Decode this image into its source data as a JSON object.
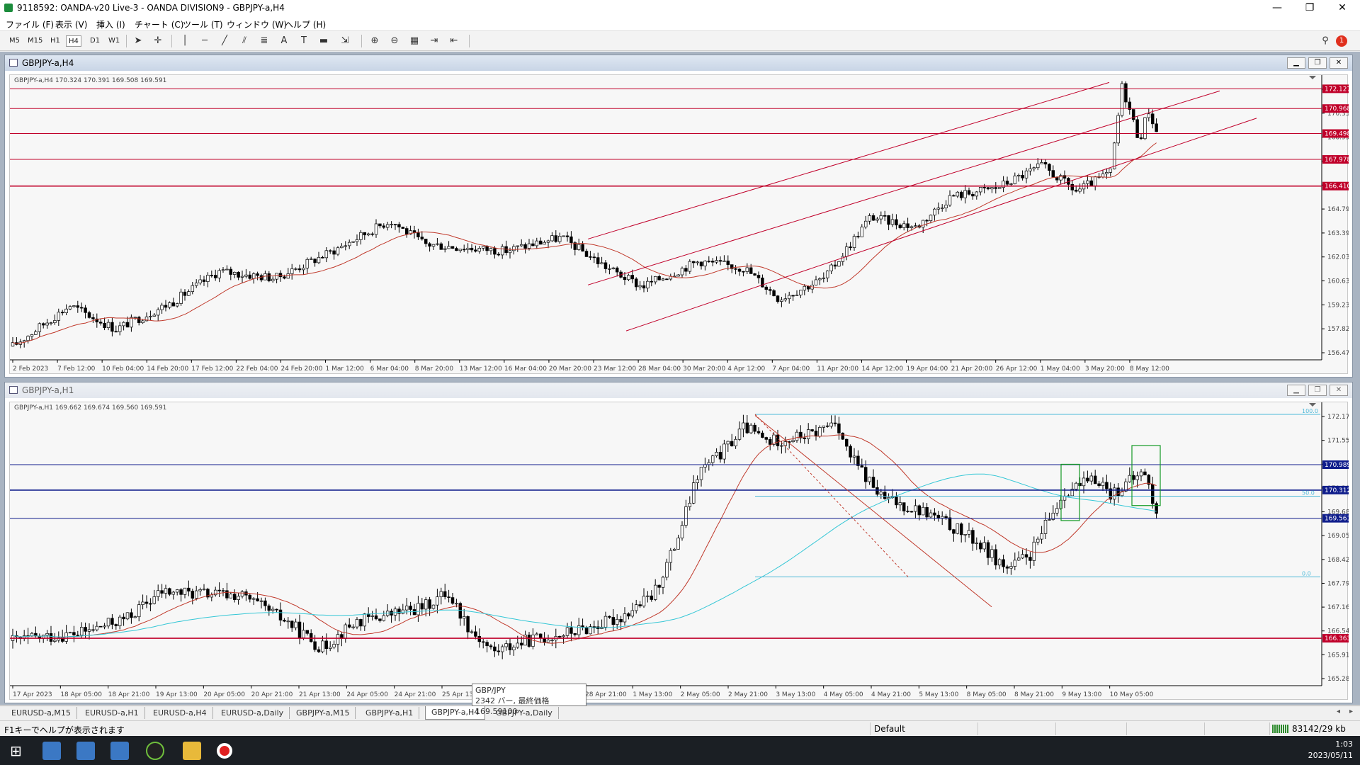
{
  "window": {
    "title": "9118592: OANDA-v20 Live-3 - OANDA DIVISION9 - GBPJPY-a,H4"
  },
  "menu": [
    "ファイル (F)",
    "表示 (V)",
    "挿入 (I)",
    "チャート (C)",
    "ツール (T)",
    "ウィンドウ (W)",
    "ヘルプ (H)"
  ],
  "toolbar": {
    "timeframes": [
      "M5",
      "M15",
      "H1",
      "H4",
      "D1",
      "W1"
    ],
    "active": "H4",
    "text_tool": "A",
    "alert_count": "1"
  },
  "colors": {
    "candle": "#000000",
    "ma_red": "#c0392b",
    "ma_cyan": "#35c7d6",
    "level_red": "#c0002a",
    "level_blue": "#101e8c",
    "box_green": "#159a26",
    "fib": "#4bb8d8"
  },
  "icons": {
    "cursor": "cursor-icon",
    "crosshair": "crosshair-icon",
    "search": "search-icon",
    "zoom_in": "zoom-in-icon",
    "zoom_out": "zoom-out-icon"
  },
  "chart_h4": {
    "window_title": "GBPJPY-a,H4",
    "info": "GBPJPY-a,H4  170.324 170.391 169.508 169.591",
    "price_ticks": [
      "171.750",
      "170.350",
      "168.950",
      "167.590",
      "166.190",
      "164.790",
      "163.390",
      "162.030",
      "160.630",
      "159.230",
      "157.820",
      "156.470"
    ],
    "level_labels": [
      {
        "price": 172.127,
        "text": "172.127"
      },
      {
        "price": 170.968,
        "text": "170.968"
      },
      {
        "price": 169.498,
        "text": "169.498"
      },
      {
        "price": 167.978,
        "text": "167.978"
      },
      {
        "price": 166.41,
        "text": "166.410"
      }
    ],
    "time_labels": [
      "2 Feb 2023",
      "7 Feb 12:00",
      "10 Feb 04:00",
      "14 Feb 20:00",
      "17 Feb 12:00",
      "22 Feb 04:00",
      "24 Feb 20:00",
      "1 Mar 12:00",
      "6 Mar 04:00",
      "8 Mar 20:00",
      "13 Mar 12:00",
      "16 Mar 04:00",
      "20 Mar 20:00",
      "23 Mar 12:00",
      "28 Mar 04:00",
      "30 Mar 20:00",
      "4 Apr 12:00",
      "7 Apr 04:00",
      "11 Apr 20:00",
      "14 Apr 12:00",
      "19 Apr 04:00",
      "21 Apr 20:00",
      "26 Apr 12:00",
      "1 May 04:00",
      "3 May 20:00",
      "8 May 12:00"
    ]
  },
  "chart_h1": {
    "window_title": "GBPJPY-a,H1",
    "info": "GBPJPY-a,H1  169.662 169.674 169.560 169.591",
    "price_ticks": [
      "172.170",
      "171.555",
      "170.935",
      "170.305",
      "169.680",
      "169.050",
      "168.420",
      "167.790",
      "167.160",
      "166.545",
      "165.915",
      "165.285"
    ],
    "level_labels": [
      {
        "price": 170.989,
        "text": "170.989",
        "color": "#101e8c"
      },
      {
        "price": 170.312,
        "text": "170.312",
        "color": "#101e8c"
      },
      {
        "price": 169.561,
        "text": "169.561",
        "color": "#101e8c"
      },
      {
        "price": 166.363,
        "text": "166.363",
        "color": "#c0002a"
      }
    ],
    "fib_labels": [
      "100.0",
      "50.0",
      "0.0"
    ],
    "time_labels": [
      "17 Apr 2023",
      "18 Apr 05:00",
      "18 Apr 21:00",
      "19 Apr 13:00",
      "20 Apr 05:00",
      "20 Apr 21:00",
      "21 Apr 13:00",
      "24 Apr 05:00",
      "24 Apr 21:00",
      "25 Apr 13:00",
      "26",
      "28 Apr 05:00",
      "28 Apr 21:00",
      "1 May 13:00",
      "2 May 05:00",
      "2 May 21:00",
      "3 May 13:00",
      "4 May 05:00",
      "4 May 21:00",
      "5 May 13:00",
      "8 May 05:00",
      "8 May 21:00",
      "9 May 13:00",
      "10 May 05:00"
    ]
  },
  "tooltip": {
    "symbol": "GBP/JPY",
    "detail": "2342 バー, 最終価格 169.59100"
  },
  "tabs": [
    "EURUSD-a,M15",
    "EURUSD-a,H1",
    "EURUSD-a,H4",
    "EURUSD-a,Daily",
    "GBPJPY-a,M15",
    "GBPJPY-a,H1",
    "GBPJPY-a,H4",
    "GBPJPY-a,Daily"
  ],
  "active_tab": "GBPJPY-a,H4",
  "status": {
    "help": "F1キーでヘルプが表示されます",
    "profile": "Default",
    "traffic": "83142/29 kb"
  },
  "clock": {
    "time": "1:03",
    "date": "2023/05/11"
  }
}
